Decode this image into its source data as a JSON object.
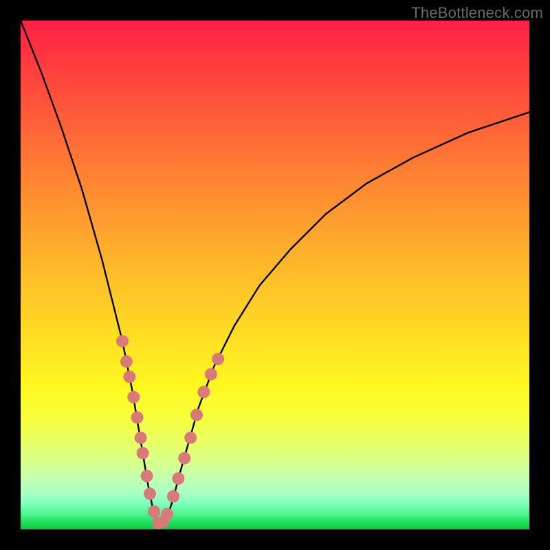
{
  "watermark": {
    "text": "TheBottleneck.com"
  },
  "colors": {
    "page_bg": "#000000",
    "curve_stroke": "#000000",
    "dot_fill": "#d87a78",
    "dot_stroke": "#7d3a38"
  },
  "chart_data": {
    "type": "line",
    "title": "",
    "xlabel": "",
    "ylabel": "",
    "xlim": [
      0,
      100
    ],
    "ylim": [
      0,
      100
    ],
    "description": "V-shaped bottleneck curve with minimum near x≈27; curve drops steeply from top-left, reaches ~0 at the trough, then rises with a gentler slope toward the right. Scatter dots cluster along the lower portions of both arms near the trough.",
    "series": [
      {
        "name": "bottleneck-curve",
        "x": [
          0,
          4,
          8,
          12,
          16,
          18,
          20,
          22,
          23,
          24,
          25,
          26,
          27,
          28,
          29,
          30,
          31,
          33,
          35,
          38,
          42,
          47,
          53,
          60,
          68,
          77,
          88,
          100
        ],
        "y": [
          100,
          90,
          79,
          67,
          53,
          45,
          37,
          27,
          21,
          15,
          9,
          4,
          1,
          1,
          3,
          6,
          10,
          17,
          24,
          32,
          40,
          48,
          55,
          62,
          68,
          73,
          78,
          82
        ]
      },
      {
        "name": "dots-left-arm",
        "x": [
          20.0,
          20.8,
          21.4,
          22.2,
          22.9,
          23.6,
          24.0,
          24.8,
          25.4,
          26.2,
          27.0
        ],
        "y": [
          37.0,
          33.0,
          30.0,
          26.0,
          22.0,
          18.0,
          15.0,
          10.5,
          7.0,
          3.5,
          1.2
        ]
      },
      {
        "name": "dots-right-arm",
        "x": [
          28.0,
          28.8,
          30.0,
          31.0,
          32.2,
          33.4,
          34.6,
          36.0,
          37.4,
          38.8
        ],
        "y": [
          1.5,
          3.0,
          6.5,
          10.0,
          14.0,
          18.0,
          22.5,
          27.0,
          30.5,
          33.5
        ]
      }
    ]
  }
}
